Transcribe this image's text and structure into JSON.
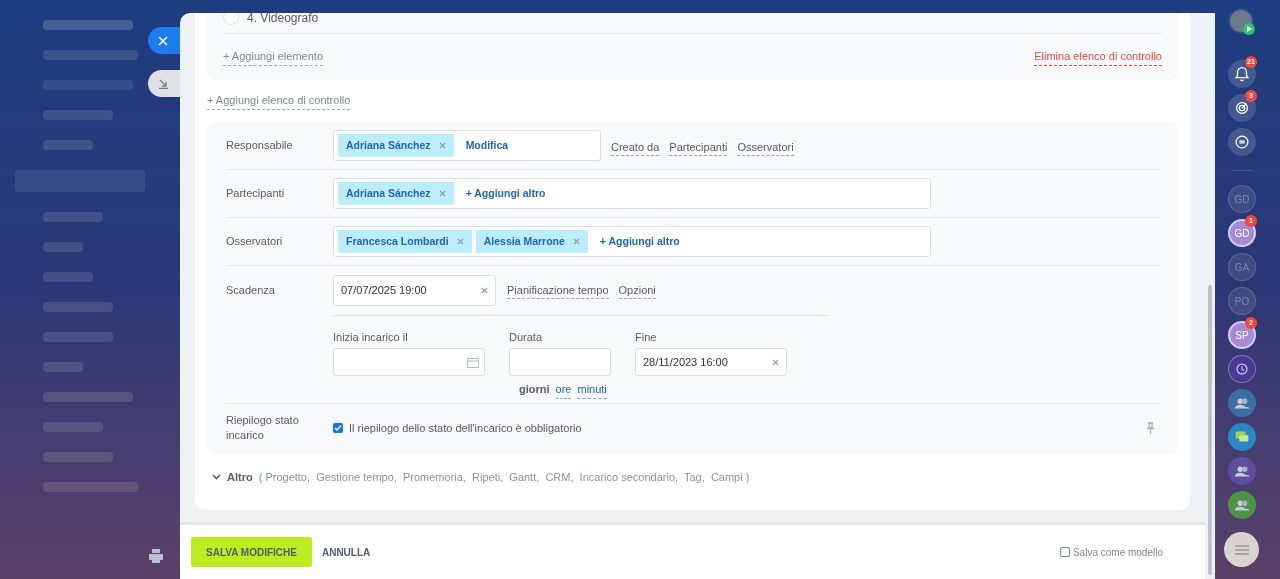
{
  "checklist": {
    "item": {
      "label": "4. Videografo",
      "checked": false
    },
    "add_item": "+ Aggiungi elemento",
    "delete_label": "Elimina elenco di controllo"
  },
  "add_checklist": "+ Aggiungi elenco di controllo",
  "responsible": {
    "label": "Responsabile",
    "tags": [
      "Adriana Sánchez"
    ],
    "action": "Modifica",
    "links": [
      "Creato da",
      "Partecipanti",
      "Osservatori"
    ]
  },
  "participants": {
    "label": "Partecipanti",
    "tags": [
      "Adriana Sánchez"
    ],
    "action": "+ Aggiungi altro"
  },
  "observers": {
    "label": "Osservatori",
    "tags": [
      "Francesca Lombardi",
      "Alessia Marrone"
    ],
    "action": "+ Aggiungi altro"
  },
  "deadline": {
    "label": "Scadenza",
    "value": "07/07/2025 19:00",
    "links": [
      "Pianificazione tempo",
      "Opzioni"
    ]
  },
  "planning": {
    "start_label": "Inizia incarico il",
    "duration_label": "Durata",
    "end_label": "Fine",
    "end_value": "28/11/2023 16:00",
    "units": [
      {
        "label": "giorni",
        "selected": true
      },
      {
        "label": "ore",
        "selected": false
      },
      {
        "label": "minuti",
        "selected": false
      }
    ]
  },
  "status_summary": {
    "label": "Riepilogo stato incarico",
    "checkbox_label": "Il riepilogo dello stato dell'incarico è obbligatorio",
    "checked": true
  },
  "more": {
    "label": "Altro",
    "sections": "( Progetto,  Gestione tempo,  Promemoria,  Ripeti,  Gantt,  CRM,  Incarico secondario,  Tag,  Campi )"
  },
  "footer": {
    "save": "SALVA MODIFICHE",
    "cancel": "ANNULLA",
    "template_label": "Salva come modello",
    "template_checked": false
  },
  "right_bar": [
    {
      "kind": "profile"
    },
    {
      "kind": "bell",
      "badge": "21"
    },
    {
      "kind": "activity",
      "badge": "3"
    },
    {
      "kind": "chat"
    },
    {
      "kind": "initials",
      "text": "GD",
      "highlighted": false
    },
    {
      "kind": "initials",
      "text": "GD",
      "highlighted": true,
      "badge": "1"
    },
    {
      "kind": "initials",
      "text": "GA",
      "highlighted": false
    },
    {
      "kind": "initials",
      "text": "PO",
      "highlighted": false
    },
    {
      "kind": "initials",
      "text": "SP",
      "highlighted": true,
      "badge": "2"
    },
    {
      "kind": "sync"
    },
    {
      "kind": "group",
      "color": "#3b6ea5"
    },
    {
      "kind": "messages",
      "color": "#2a86c5"
    },
    {
      "kind": "group",
      "color": "#5e4f9e"
    },
    {
      "kind": "group",
      "color": "#4f9247"
    }
  ]
}
